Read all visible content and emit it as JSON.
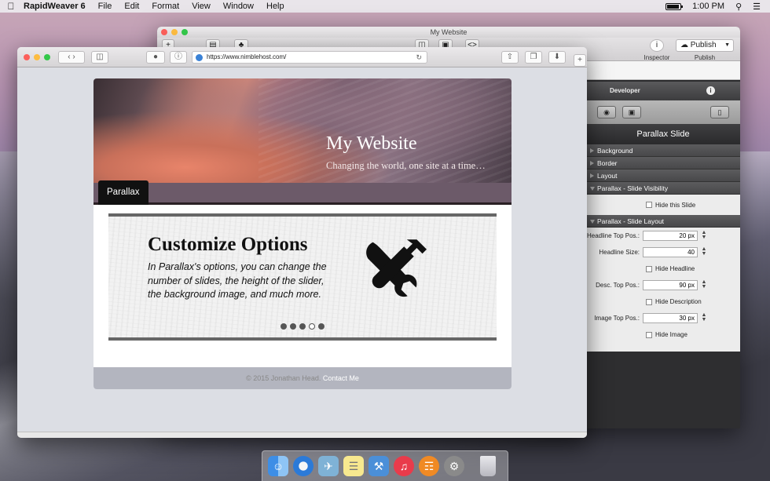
{
  "menubar": {
    "app": "RapidWeaver 6",
    "items": [
      "File",
      "Edit",
      "Format",
      "View",
      "Window",
      "Help"
    ],
    "clock": "1:00 PM"
  },
  "rw_window": {
    "title": "My Website",
    "inspector_label": "Inspector",
    "publish_label": "Publish",
    "publish_caption": "Publish"
  },
  "inspector": {
    "header": "Developer",
    "title": "Parallax Slide",
    "sections": [
      "Background",
      "Border",
      "Layout"
    ],
    "visibility_section": "Parallax - Slide Visibility",
    "hide_slide": "Hide this Slide",
    "layout_section": "Parallax - Slide Layout",
    "fields": [
      {
        "label": "Headline Top Pos.:",
        "value": "20 px"
      },
      {
        "label": "Headline Size:",
        "value": "40"
      },
      {
        "label": "Desc. Top Pos.:",
        "value": "90 px"
      },
      {
        "label": "Image Top Pos.:",
        "value": "30 px"
      }
    ],
    "hide_headline": "Hide Headline",
    "hide_description": "Hide Description",
    "hide_image": "Hide Image"
  },
  "browser": {
    "url": "https://www.nimblehost.com/"
  },
  "site": {
    "title": "My Website",
    "subtitle": "Changing the world, one site at a time…",
    "nav": [
      "Parallax"
    ],
    "slide_headline": "Customize Options",
    "slide_description": "In Parallax's options, you can change the number of slides, the height of the slider, the background image, and much more.",
    "slide_count": 5,
    "active_slide": 4,
    "footer_text": "© 2015 Jonathan Head.",
    "footer_link": "Contact Me"
  },
  "dock": {
    "icons": [
      "finder-icon",
      "safari-icon",
      "preview-icon",
      "notes-icon",
      "xcode-icon",
      "itunes-icon",
      "ibooks-icon",
      "system-preferences-icon",
      "trash-icon"
    ]
  },
  "colors": {
    "nav_bar": "#6c5a69",
    "footer": "#b3b5bf",
    "accent_link": "#ffffff"
  }
}
